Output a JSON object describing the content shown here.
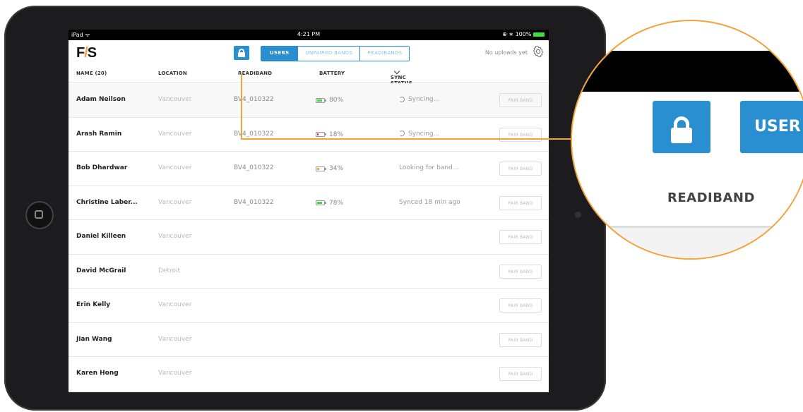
{
  "status_bar": {
    "left": "iPad ᯤ",
    "time": "4:21 PM",
    "right": "⊕ ∗ 100%"
  },
  "app": {
    "logo_f": "F",
    "logo_slash": "/",
    "logo_s": "S",
    "tabs": [
      {
        "label": "USERS",
        "active": true
      },
      {
        "label": "UNPAIRED BANDS",
        "active": false
      },
      {
        "label": "READIBANDS",
        "active": false
      }
    ],
    "uploads_text": "No uploads yet"
  },
  "columns": {
    "name": "NAME (20)",
    "location": "LOCATION",
    "readiband": "READIBAND",
    "battery": "BATTERY",
    "sync_status": "SYNC STATUS"
  },
  "pair_label": "PAIR BAND",
  "rows": [
    {
      "name": "Adam Neilson",
      "location": "Vancouver",
      "band": "BV4_010322",
      "battery": "80%",
      "battery_level": 0.8,
      "battery_color": "#3ddc3d",
      "sync": "Syncing...",
      "syncing": true
    },
    {
      "name": "Arash Ramin",
      "location": "Vancouver",
      "band": "BV4_010322",
      "battery": "18%",
      "battery_level": 0.18,
      "battery_color": "#e53935",
      "sync": "Syncing...",
      "syncing": true
    },
    {
      "name": "Bob Dhardwar",
      "location": "Vancouver",
      "band": "BV4_010322",
      "battery": "34%",
      "battery_level": 0.34,
      "battery_color": "#f2a33a",
      "sync": "Looking for band...",
      "syncing": false
    },
    {
      "name": "Christine Laber...",
      "location": "Vancouver",
      "band": "BV4_010322",
      "battery": "78%",
      "battery_level": 0.78,
      "battery_color": "#3ddc3d",
      "sync": "Synced 18 min ago",
      "syncing": false
    },
    {
      "name": "Daniel Killeen",
      "location": "Vancouver",
      "band": "",
      "battery": "",
      "sync": "",
      "syncing": false
    },
    {
      "name": "David McGrail",
      "location": "Detroit",
      "band": "",
      "battery": "",
      "sync": "",
      "syncing": false
    },
    {
      "name": "Erin Kelly",
      "location": "Vancouver",
      "band": "",
      "battery": "",
      "sync": "",
      "syncing": false
    },
    {
      "name": "Jian Wang",
      "location": "Vancouver",
      "band": "",
      "battery": "",
      "sync": "",
      "syncing": false
    },
    {
      "name": "Karen Hong",
      "location": "Vancouver",
      "band": "",
      "battery": "",
      "sync": "",
      "syncing": false
    }
  ],
  "magnifier": {
    "users_label": "USER",
    "readiband_label": "READIBAND"
  },
  "colors": {
    "accent": "#2a8fd0",
    "callout": "#f2a33a"
  }
}
